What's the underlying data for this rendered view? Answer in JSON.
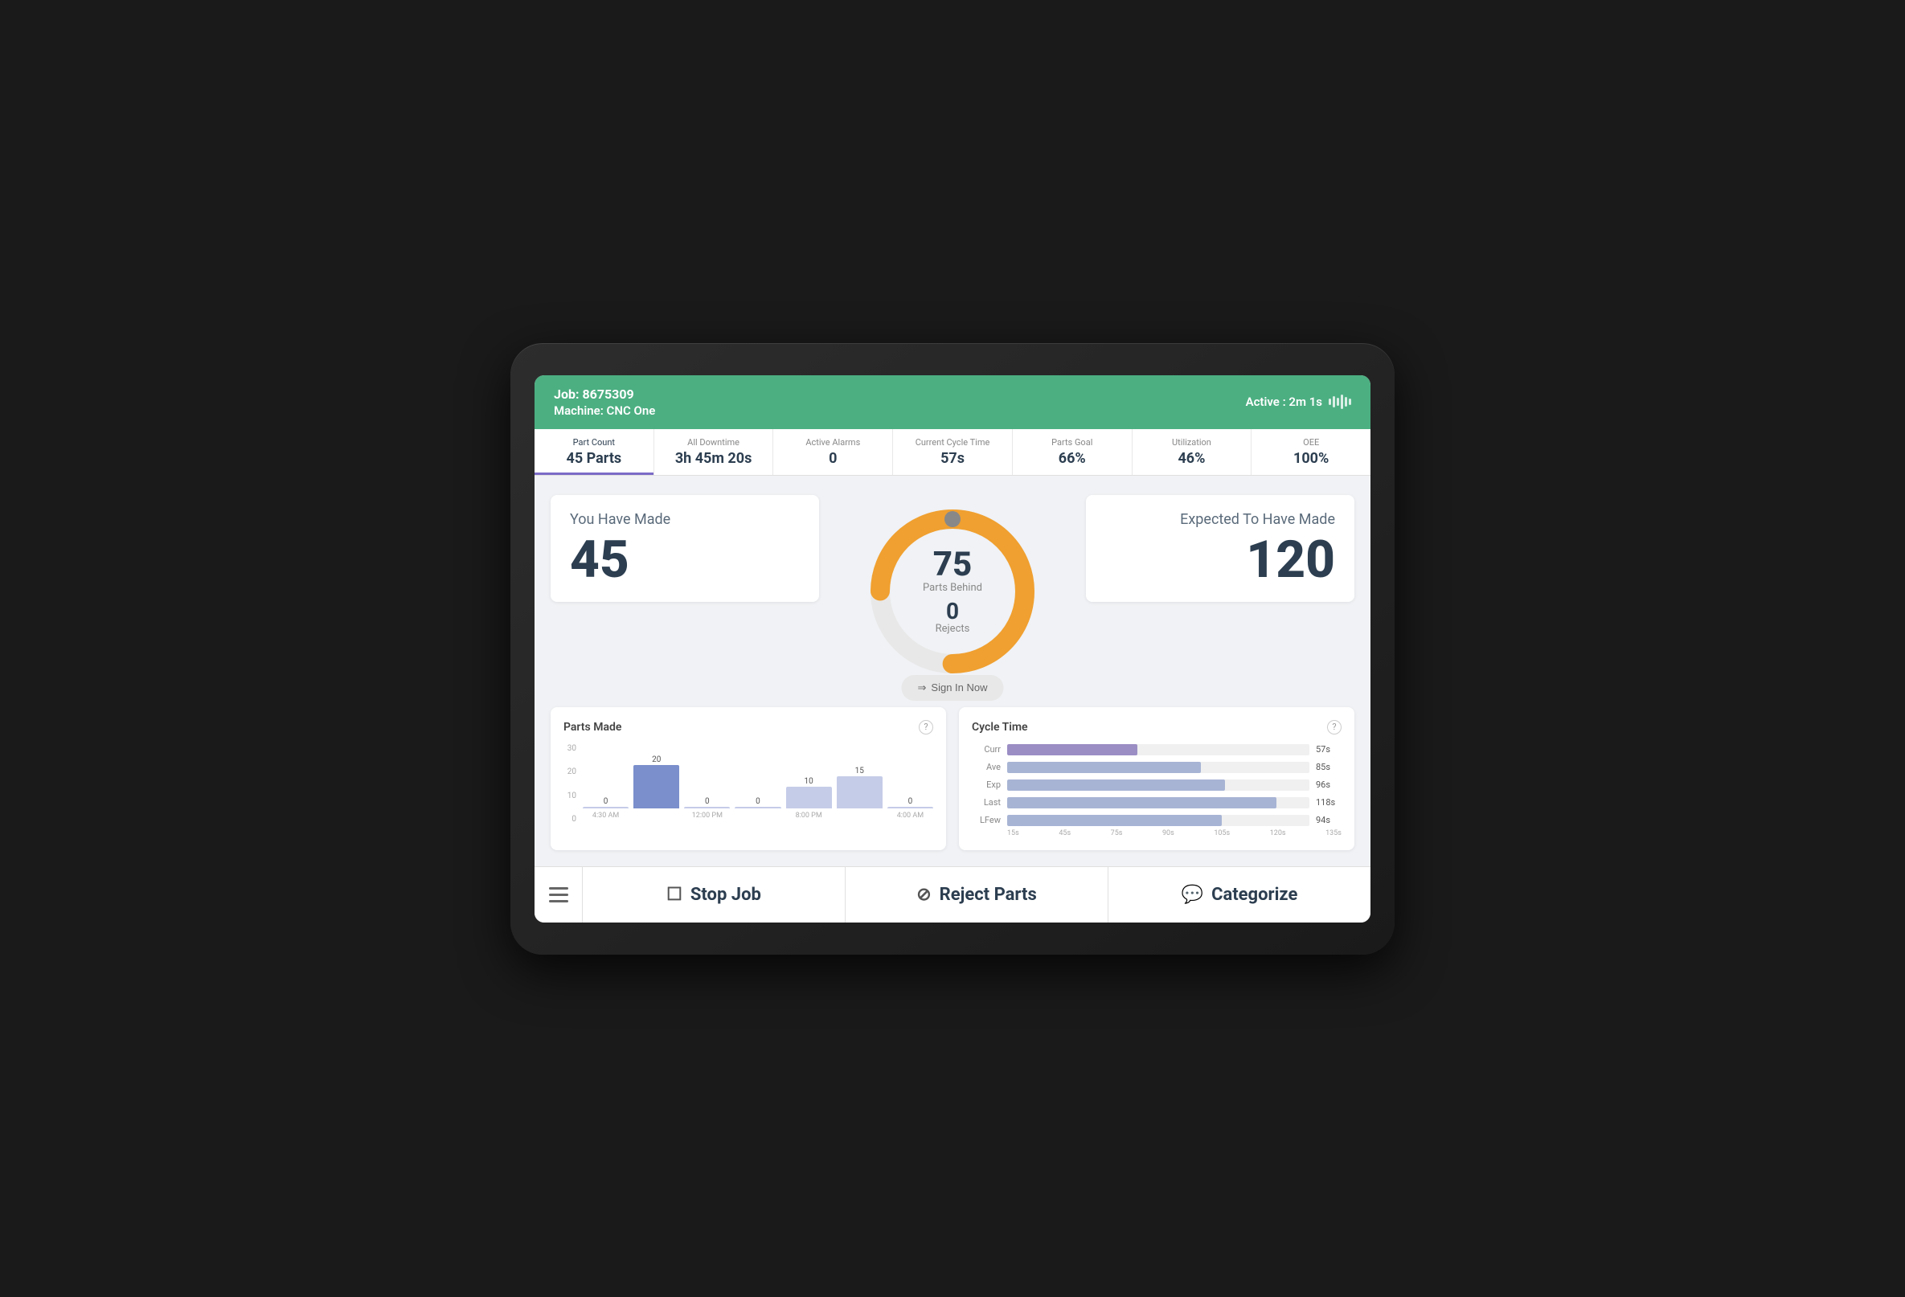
{
  "header": {
    "job_label": "Job: 8675309",
    "machine_label": "Machine: CNC One",
    "status_label": "Active : 2m 1s"
  },
  "metrics": [
    {
      "label": "Part Count",
      "value": "45 Parts",
      "active": true
    },
    {
      "label": "All Downtime",
      "value": "3h 45m 20s",
      "active": false
    },
    {
      "label": "Active Alarms",
      "value": "0",
      "active": false
    },
    {
      "label": "Current Cycle Time",
      "value": "57s",
      "active": false
    },
    {
      "label": "Parts Goal",
      "value": "66%",
      "active": false
    },
    {
      "label": "Utilization",
      "value": "46%",
      "active": false
    },
    {
      "label": "OEE",
      "value": "100%",
      "active": false
    }
  ],
  "made_section": {
    "title": "You Have Made",
    "value": "45"
  },
  "expected_section": {
    "title": "Expected To Have Made",
    "value": "120"
  },
  "donut": {
    "parts_behind": "75",
    "parts_behind_label": "Parts Behind",
    "rejects": "0",
    "rejects_label": "Rejects",
    "sign_in_label": "Sign In Now",
    "total": 120,
    "made": 45
  },
  "parts_made_chart": {
    "title": "Parts Made",
    "y_labels": [
      "30",
      "20",
      "10",
      "0"
    ],
    "bars": [
      {
        "time": "4:30 AM",
        "value": 0,
        "height_pct": 0
      },
      {
        "time": "",
        "value": 20,
        "height_pct": 67
      },
      {
        "time": "12:00 PM",
        "value": 0,
        "height_pct": 0
      },
      {
        "time": "",
        "value": 0,
        "height_pct": 0
      },
      {
        "time": "8:00 PM",
        "value": 10,
        "height_pct": 33
      },
      {
        "time": "",
        "value": 15,
        "height_pct": 50
      },
      {
        "time": "4:00 AM",
        "value": 0,
        "height_pct": 2
      }
    ]
  },
  "cycle_time_chart": {
    "title": "Cycle Time",
    "rows": [
      {
        "label": "Curr",
        "value": "57s",
        "pct": 43,
        "type": "curr"
      },
      {
        "label": "Ave",
        "value": "85s",
        "pct": 64,
        "type": "ave"
      },
      {
        "label": "Exp",
        "value": "96s",
        "pct": 72,
        "type": "exp"
      },
      {
        "label": "Last",
        "value": "118s",
        "pct": 89,
        "type": "last"
      },
      {
        "label": "LFew",
        "value": "94s",
        "pct": 71,
        "type": "lfew"
      }
    ],
    "x_labels": [
      "15s",
      "45s",
      "75s",
      "90s",
      "105s",
      "120s",
      "135s"
    ]
  },
  "footer": {
    "stop_job_label": "Stop Job",
    "reject_parts_label": "Reject Parts",
    "categorize_label": "Categorize"
  }
}
